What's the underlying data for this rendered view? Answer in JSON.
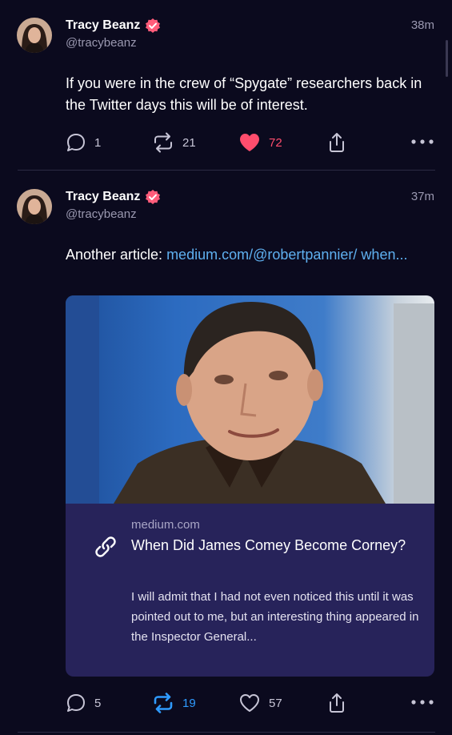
{
  "posts": [
    {
      "author_name": "Tracy Beanz",
      "handle": "@tracybeanz",
      "time": "38m",
      "text": "If you were in the crew of “Spygate” researchers back in the Twitter days this will be of interest.",
      "replies": "1",
      "reposts": "21",
      "likes": "72",
      "liked": true
    },
    {
      "author_name": "Tracy Beanz",
      "handle": "@tracybeanz",
      "time": "37m",
      "text_prefix": "Another article: ",
      "link_text": "medium.com/@robertpannier/ when...",
      "card": {
        "domain": "medium.com",
        "title": "When Did James Comey Become Corney?",
        "description": "I will admit that I had not even noticed this until it was pointed out to me, but an interesting thing appeared in the Inspector General..."
      },
      "replies": "5",
      "reposts": "19",
      "likes": "57",
      "reposted": true
    }
  ],
  "colors": {
    "background": "#0b0a1e",
    "like_active": "#ff4d6d",
    "repost_active": "#2f9bff",
    "link": "#5fb0f0",
    "card_bg": "#27235a"
  },
  "icons": [
    "reply-icon",
    "repost-icon",
    "like-icon",
    "share-icon",
    "more-icon",
    "verified-icon",
    "link-icon"
  ]
}
